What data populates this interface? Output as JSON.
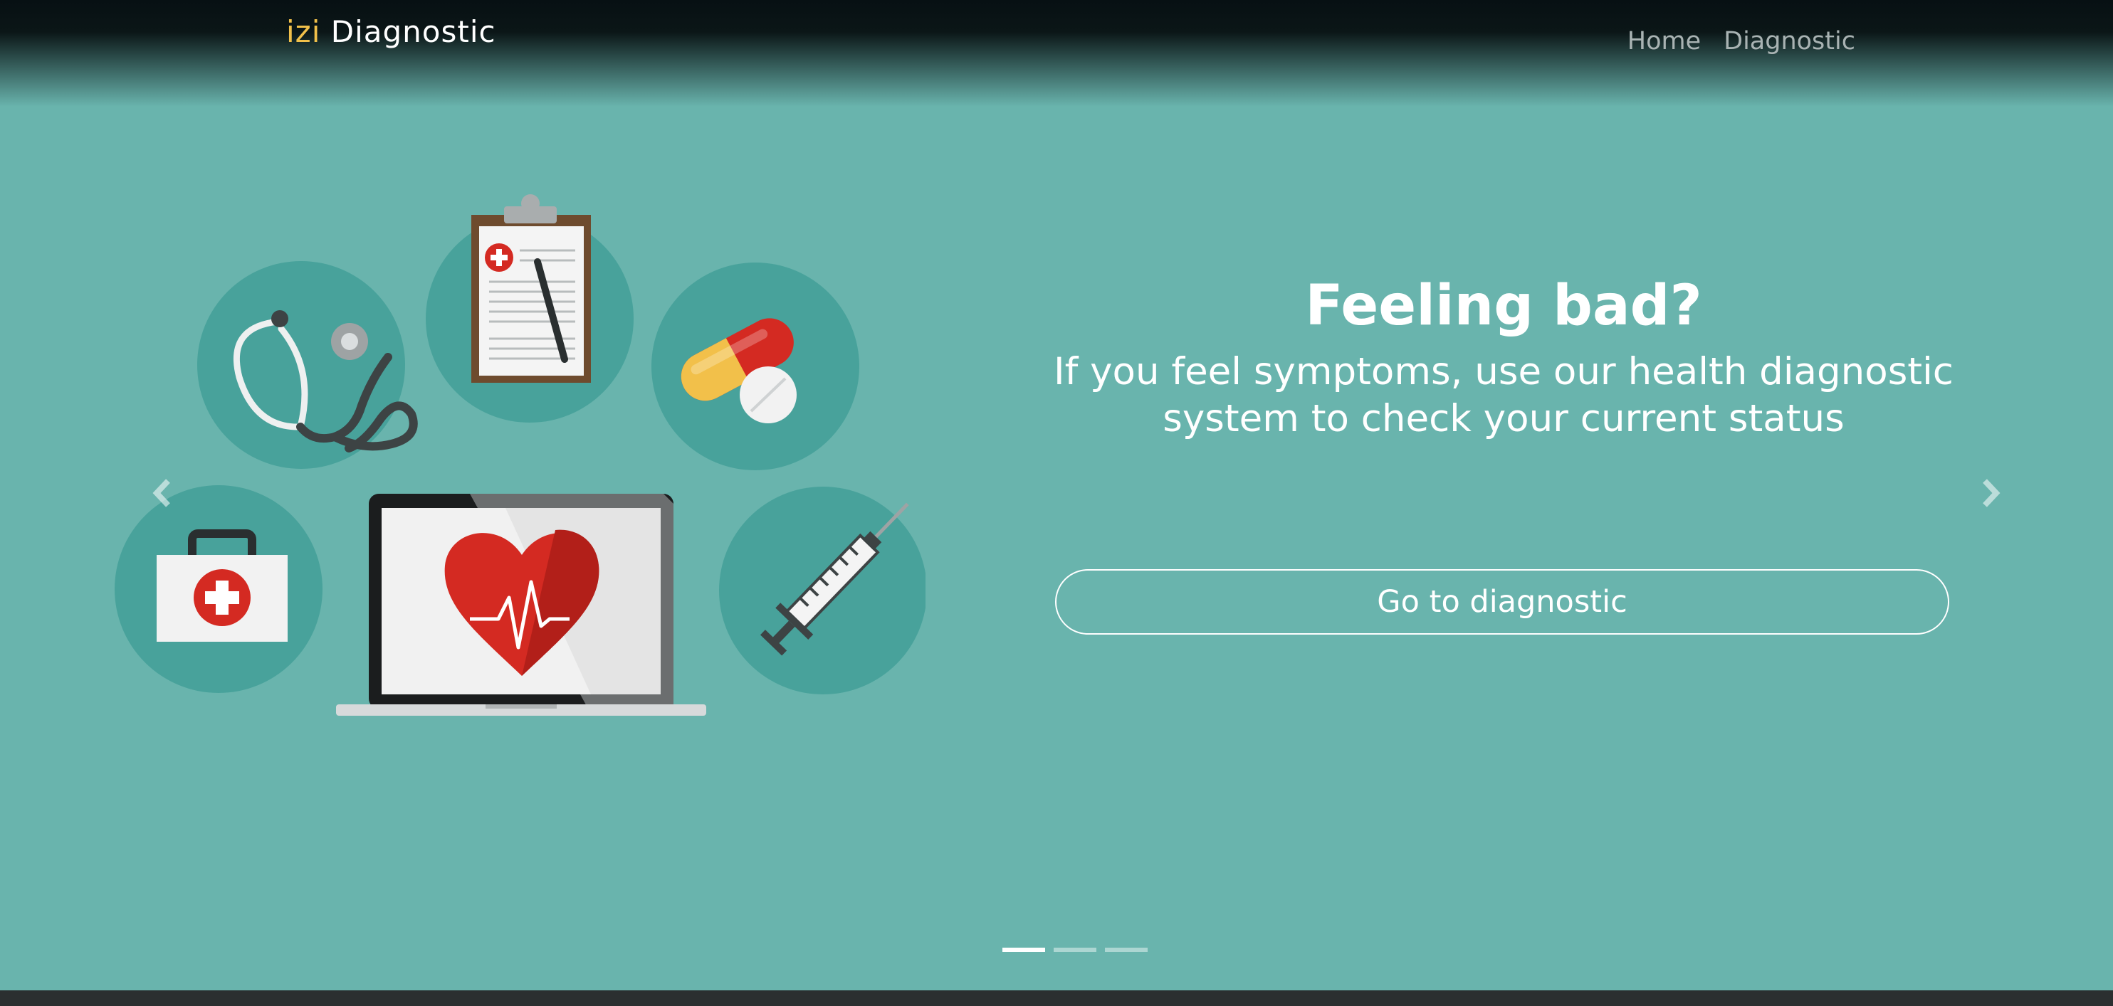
{
  "navbar": {
    "brand_prefix": "izi",
    "brand_name": "Diagnostic",
    "links": [
      {
        "label": "Home"
      },
      {
        "label": "Diagnostic"
      }
    ]
  },
  "carousel": {
    "heading": "Feeling bad?",
    "subtext": "If you feel symptoms, use our health diagnostic system to check your current status",
    "cta_label": "Go to diagnostic",
    "slide_count": 3,
    "active_slide": 1,
    "prev_icon": "chevron-left-icon",
    "next_icon": "chevron-right-icon"
  },
  "colors": {
    "background": "#69b4ad",
    "circle": "#48a29b",
    "navbar": "#071013",
    "brand_accent": "#f1c04a",
    "heart": "#d42a22"
  }
}
